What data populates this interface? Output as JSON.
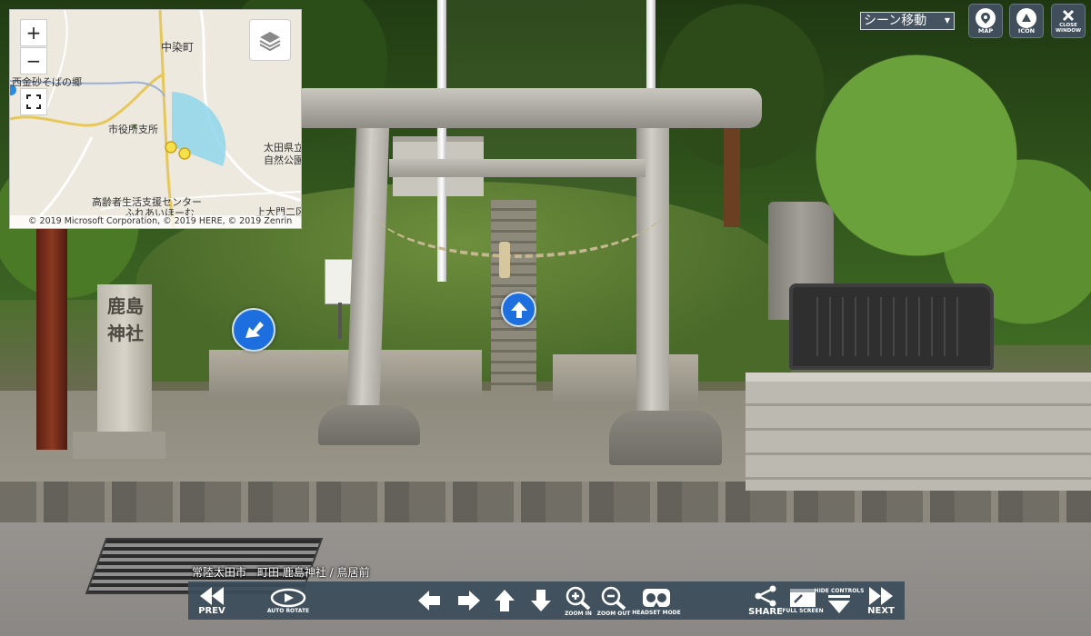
{
  "map": {
    "zoom_in_label": "+",
    "zoom_out_label": "−",
    "labels": {
      "nakazome": "中染町",
      "nishikanasa": "西金砂そばの郷",
      "shiyakusho": "市役所支所",
      "ota_park_1": "太田県立",
      "ota_park_2": "自然公園",
      "koureisha_1": "高齢者生活支援センター",
      "koureisha_2": "ふれあいほーむ",
      "kamiotakado": "上大門二区"
    },
    "copyright": "© 2019 Microsoft Corporation, © 2019 HERE, © 2019 Zenrin"
  },
  "header": {
    "scene_select_value": "シーン移動",
    "map_label": "MAP",
    "icon_label": "ICON",
    "close_window_label": "CLOSE WINDOW"
  },
  "scene": {
    "pillar_text": "鹿島神社",
    "caption": "常陸太田市　町田 鹿島神社 / 鳥居前"
  },
  "controls": {
    "prev": "PREV",
    "auto_rotate": "AUTO ROTATE",
    "zoom_in": "ZOOM IN",
    "zoom_out": "ZOOM OUT",
    "headset_mode": "HEADSET MODE",
    "share": "SHARE",
    "full_screen": "FULL SCREEN",
    "hide_controls": "HIDE CONTROLS",
    "next": "NEXT"
  },
  "colors": {
    "control_bar": "#3c4c5a",
    "hotspot": "#1d6fe0",
    "map_view_cone": "#8fd6ec",
    "map_marker": "#f4e04a"
  },
  "icons": [
    "plus-icon",
    "minus-icon",
    "fullscreen-icon",
    "layers-icon",
    "map-pin-icon",
    "triangle-icon",
    "close-icon",
    "arrow-left-icon",
    "arrow-right-icon",
    "arrow-up-icon",
    "arrow-down-icon",
    "zoom-in-icon",
    "zoom-out-icon",
    "headset-icon",
    "share-icon",
    "fullscreen-window-icon",
    "hide-controls-icon",
    "prev-icon",
    "next-icon",
    "auto-rotate-icon"
  ]
}
